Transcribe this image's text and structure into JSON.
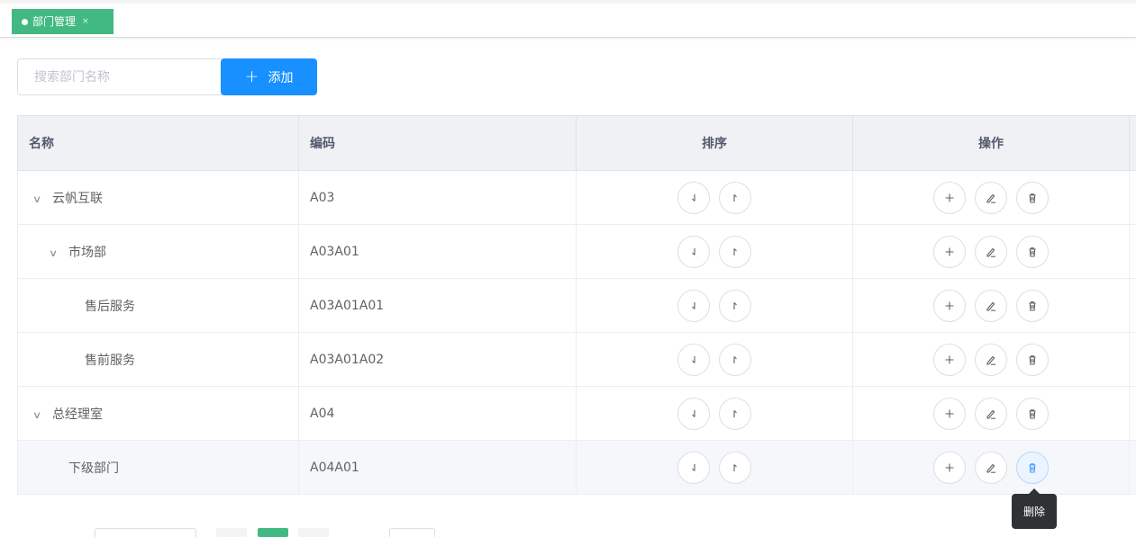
{
  "tabs": [
    {
      "label": "部门管理",
      "close": "×",
      "active": true
    }
  ],
  "toolbar": {
    "search_placeholder": "搜索部门名称",
    "add_label": "添加",
    "add_icon": "plus-icon"
  },
  "table": {
    "headers": {
      "name": "名称",
      "code": "编码",
      "sort": "排序",
      "ops": "操作"
    },
    "rows": [
      {
        "name": "云帆互联",
        "code": "A03",
        "level": 0,
        "expanded": true
      },
      {
        "name": "市场部",
        "code": "A03A01",
        "level": 1,
        "expanded": true
      },
      {
        "name": "售后服务",
        "code": "A03A01A01",
        "level": 2,
        "expanded": null
      },
      {
        "name": "售前服务",
        "code": "A03A01A02",
        "level": 2,
        "expanded": null
      },
      {
        "name": "总经理室",
        "code": "A04",
        "level": 0,
        "expanded": true
      },
      {
        "name": "下级部门",
        "code": "A04A01",
        "level": 1,
        "expanded": null,
        "hover": true
      }
    ],
    "sort_icons": [
      "arrow-down-icon",
      "arrow-up-icon"
    ],
    "op_icons": [
      "plus-icon",
      "edit-icon",
      "delete-icon"
    ]
  },
  "tooltip": {
    "text": "删除"
  },
  "colors": {
    "tag_active": "#42b983",
    "primary": "#1890ff",
    "tooltip_bg": "#303133"
  }
}
